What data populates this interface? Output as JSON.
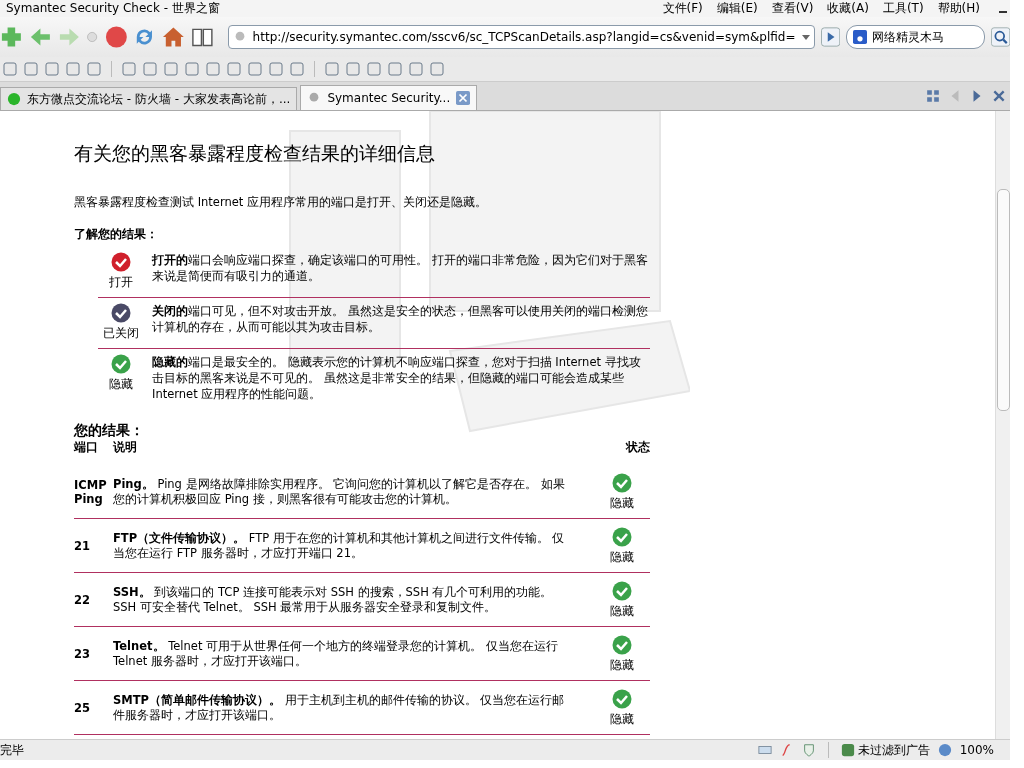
{
  "window": {
    "title": "Symantec Security Check - 世界之窗"
  },
  "menu": [
    "文件(F)",
    "编辑(E)",
    "查看(V)",
    "收藏(A)",
    "工具(T)",
    "帮助(H)"
  ],
  "address_bar": {
    "value": "http://security.symantec.com/sscv6/sc_TCPScanDetails.asp?langid=cs&venid=sym&plfid="
  },
  "search": {
    "value": "网络精灵木马"
  },
  "tabs": [
    {
      "label": "东方微点交流论坛 - 防火墙 - 大家发表高论前，...",
      "selected": false
    },
    {
      "label": "Symantec Security...",
      "selected": true
    }
  ],
  "page": {
    "heading": "有关您的黑客暴露程度检查结果的详细信息",
    "intro": "黑客暴露程度检查测试 Internet 应用程序常用的端口是打开、关闭还是隐藏。",
    "legend_title": "了解您的结果：",
    "legend": [
      {
        "kind": "open",
        "label": "打开",
        "text": "**打开的**端口会响应端口探查，确定该端口的可用性。 打开的端口非常危险，因为它们对于黑客来说是简便而有吸引力的通道。"
      },
      {
        "kind": "closed",
        "label": "已关闭",
        "text": "**关闭的**端口可见，但不对攻击开放。 虽然这是安全的状态，但黑客可以使用关闭的端口检测您计算机的存在，从而可能以其为攻击目标。"
      },
      {
        "kind": "stealth",
        "label": "隐藏",
        "text": "**隐藏的**端口是最安全的。 隐藏表示您的计算机不响应端口探查，您对于扫描 Internet 寻找攻击目标的黑客来说是不可见的。 虽然这是非常安全的结果，但隐藏的端口可能会造成某些 Internet 应用程序的性能问题。"
      }
    ],
    "results_title": "您的结果：",
    "columns": [
      "端口",
      "说明",
      "状态"
    ],
    "rows": [
      {
        "port": "ICMP Ping",
        "description": "**Ping。** Ping 是网络故障排除实用程序。 它询问您的计算机以了解它是否存在。 如果您的计算机积极回应 Ping 接，则黑客很有可能攻击您的计算机。",
        "kind": "stealth",
        "status": "隐藏"
      },
      {
        "port": "21",
        "description": "**FTP（文件传输协议）。** FTP 用于在您的计算机和其他计算机之间进行文件传输。 仅当您在运行 FTP 服务器时，才应打开端口 21。",
        "kind": "stealth",
        "status": "隐藏"
      },
      {
        "port": "22",
        "description": "**SSH。** 到该端口的 TCP 连接可能表示对 SSH 的搜索，SSH 有几个可利用的功能。 SSH 可安全替代 Telnet。 SSH 最常用于从服务器安全登录和复制文件。",
        "kind": "stealth",
        "status": "隐藏"
      },
      {
        "port": "23",
        "description": "**Telnet。** Telnet 可用于从世界任何一个地方的终端登录您的计算机。 仅当您在运行 Telnet 服务器时，才应打开该端口。",
        "kind": "stealth",
        "status": "隐藏"
      },
      {
        "port": "25",
        "description": "**SMTP（简单邮件传输协议）。** 用于主机到主机的邮件传输的协议。 仅当您在运行邮件服务器时，才应打开该端口。",
        "kind": "stealth",
        "status": "隐藏"
      }
    ]
  },
  "status_bar": {
    "text": "完毕",
    "ad_filter": "未过滤到广告",
    "zoom": "100%"
  }
}
